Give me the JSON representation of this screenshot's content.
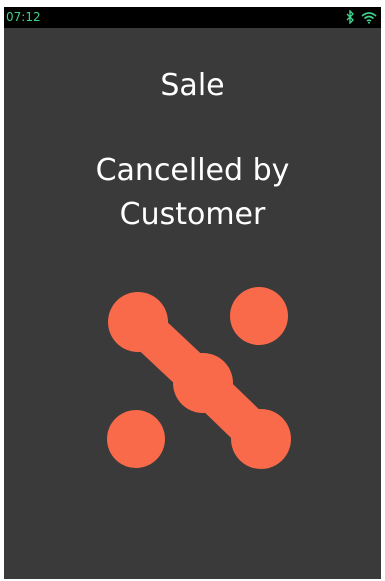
{
  "status_bar": {
    "time": "07:12",
    "icons": [
      "bluetooth-icon",
      "wifi-icon"
    ],
    "text_color": "#3fd08a"
  },
  "screen": {
    "title": "Sale",
    "message_line1": "Cancelled by",
    "message_line2": "Customer",
    "background_color": "#3a3a3a",
    "text_color": "#ffffff"
  },
  "logo": {
    "icon": "cancelled-x-logo",
    "color": "#f96a4a"
  }
}
